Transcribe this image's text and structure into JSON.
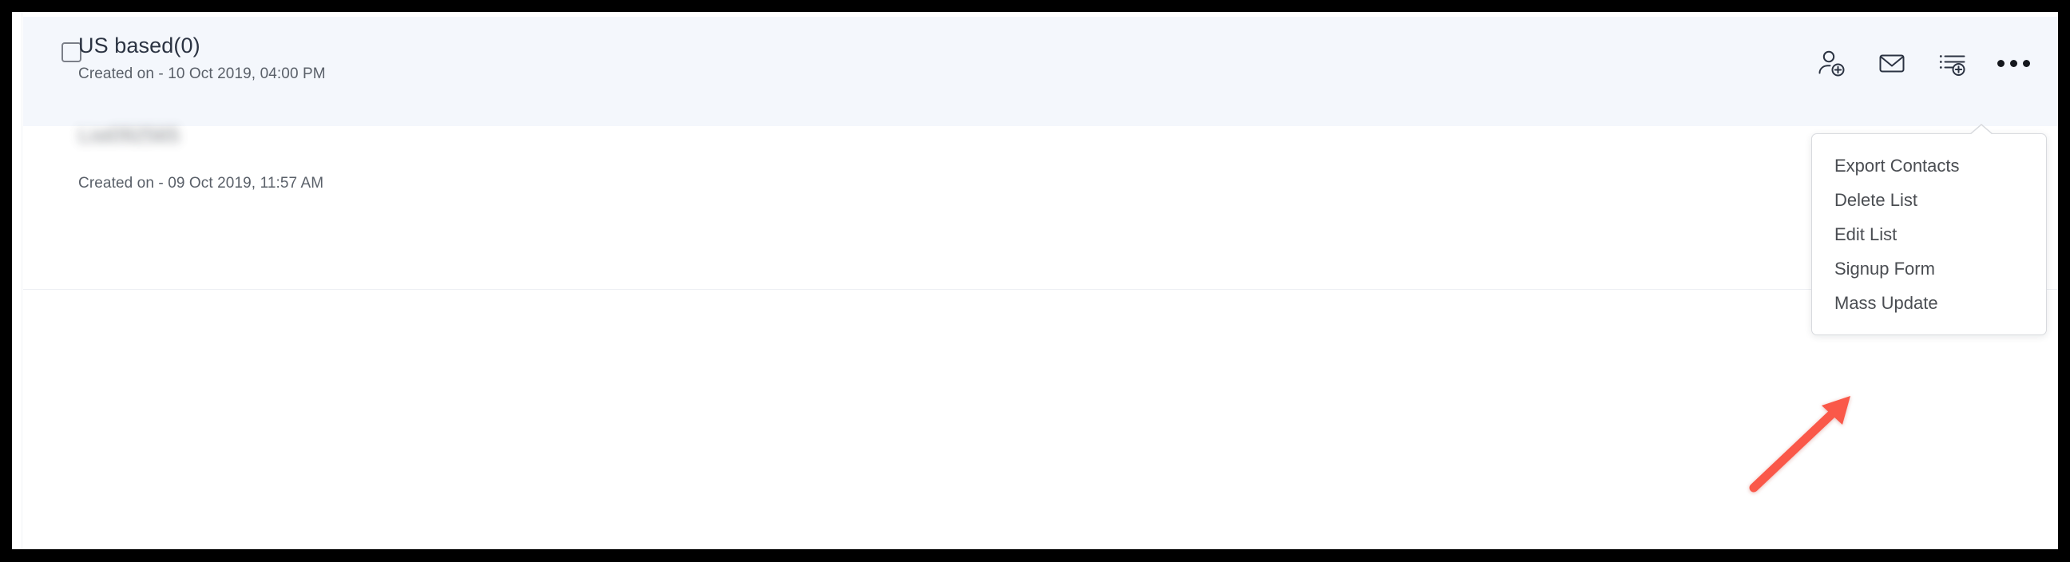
{
  "window": {
    "background": "#ffffff",
    "selected_row_background": "#f4f7fc",
    "divider_color": "#edeff3"
  },
  "lists": [
    {
      "name": "US based(0)",
      "created_label": "Created on - 10 Oct 2019, 04:00 PM",
      "selected": true,
      "redacted": false,
      "checkbox_checked": false
    },
    {
      "name": "List092565",
      "created_label": "Created on - 09 Oct 2019, 11:57 AM",
      "selected": false,
      "redacted": true,
      "checkbox_checked": false
    }
  ],
  "toolbar": {
    "icons": [
      {
        "name": "add-contact-icon",
        "title": "Add Contact"
      },
      {
        "name": "send-email-icon",
        "title": "Send Email"
      },
      {
        "name": "add-to-list-icon",
        "title": "Add to List"
      },
      {
        "name": "more-options-icon",
        "title": "More"
      }
    ]
  },
  "dropdown": {
    "open": true,
    "items": [
      {
        "label": "Export Contacts"
      },
      {
        "label": "Delete List"
      },
      {
        "label": "Edit List"
      },
      {
        "label": "Signup Form"
      },
      {
        "label": "Mass Update"
      }
    ]
  },
  "annotation": {
    "type": "arrow",
    "color": "#fa584a",
    "points_to": "Mass Update"
  }
}
